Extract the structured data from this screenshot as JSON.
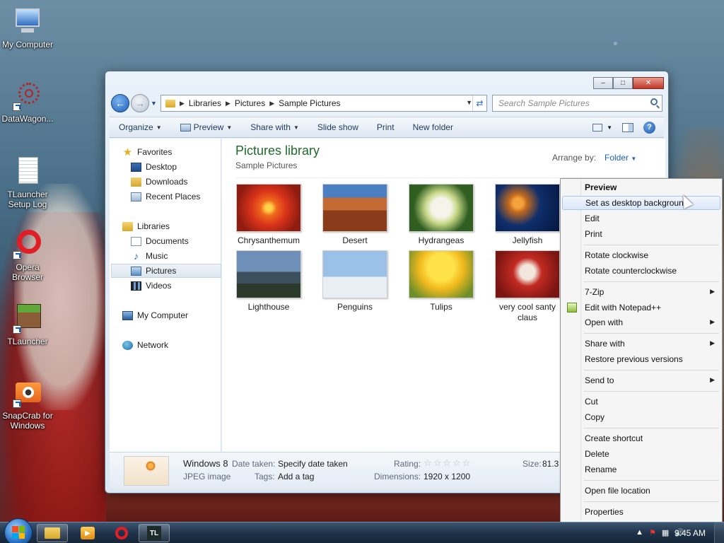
{
  "desktop": {
    "icons": [
      {
        "label": "My Computer"
      },
      {
        "label": "DataWagon..."
      },
      {
        "label": "TLauncher Setup Log"
      },
      {
        "label": "Opera Browser"
      },
      {
        "label": "TLauncher"
      },
      {
        "label": "SnapCrab for Windows"
      }
    ]
  },
  "window": {
    "controls": {
      "minimize": "–",
      "maximize": "□",
      "close": "✕"
    },
    "breadcrumb": [
      "Libraries",
      "Pictures",
      "Sample Pictures"
    ],
    "search_placeholder": "Search Sample Pictures",
    "toolbar": {
      "organize": "Organize",
      "preview": "Preview",
      "share_with": "Share with",
      "slide_show": "Slide show",
      "print": "Print",
      "new_folder": "New folder",
      "help": "?"
    },
    "navpane": {
      "favorites": "Favorites",
      "desktop": "Desktop",
      "downloads": "Downloads",
      "recent_places": "Recent Places",
      "libraries": "Libraries",
      "documents": "Documents",
      "music": "Music",
      "pictures": "Pictures",
      "videos": "Videos",
      "my_computer": "My Computer",
      "network": "Network"
    },
    "content": {
      "title": "Pictures library",
      "subtitle": "Sample Pictures",
      "arrange_by_label": "Arrange by:",
      "arrange_by_value": "Folder",
      "files": [
        {
          "name": "Chrysanthemum"
        },
        {
          "name": "Desert"
        },
        {
          "name": "Hydrangeas"
        },
        {
          "name": "Jellyfish"
        },
        {
          "name": "Lighthouse"
        },
        {
          "name": "Penguins"
        },
        {
          "name": "Tulips"
        },
        {
          "name": "very cool santy claus"
        }
      ]
    },
    "details": {
      "name": "Windows 8",
      "type": "JPEG image",
      "date_taken_label": "Date taken:",
      "date_taken_value": "Specify date taken",
      "tags_label": "Tags:",
      "tags_value": "Add a tag",
      "rating_label": "Rating:",
      "rating_stars": "☆☆☆☆☆",
      "dimensions_label": "Dimensions:",
      "dimensions_value": "1920 x 1200",
      "size_label": "Size:",
      "size_value": "81.3"
    }
  },
  "context_menu": {
    "preview": "Preview",
    "set_desktop_background": "Set as desktop background",
    "edit": "Edit",
    "print": "Print",
    "rotate_clockwise": "Rotate clockwise",
    "rotate_counterclockwise": "Rotate counterclockwise",
    "seven_zip": "7-Zip",
    "edit_notepad": "Edit with Notepad++",
    "open_with": "Open with",
    "share_with": "Share with",
    "restore_previous": "Restore previous versions",
    "send_to": "Send to",
    "cut": "Cut",
    "copy": "Copy",
    "create_shortcut": "Create shortcut",
    "delete": "Delete",
    "rename": "Rename",
    "open_file_location": "Open file location",
    "properties": "Properties"
  },
  "taskbar": {
    "clock": "9:45 AM",
    "pinned": [
      "explorer-icon",
      "media-player-icon",
      "opera-icon",
      "tlauncher-icon"
    ],
    "tlauncher_label": "TL"
  },
  "colors": {
    "library_title": "#1e6b2c",
    "link_blue": "#1c5fb8",
    "taskbar": "#20334a"
  }
}
